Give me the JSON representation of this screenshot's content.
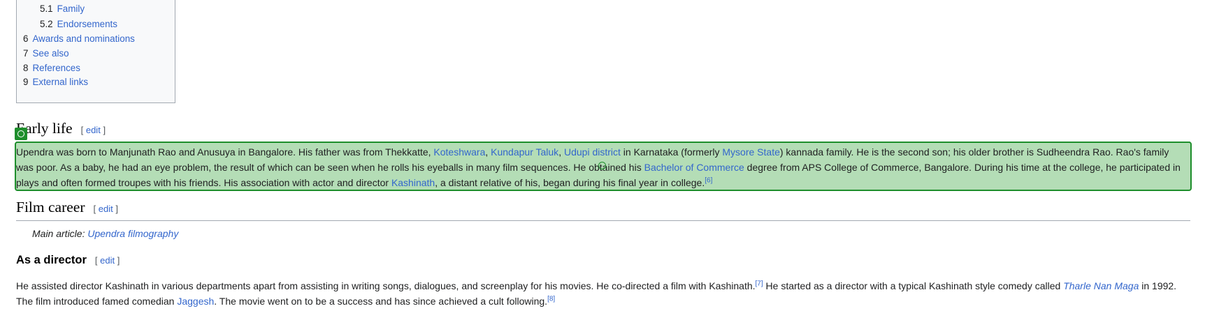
{
  "toc": {
    "items": [
      {
        "num": "5.1",
        "label": "Family",
        "indent": true
      },
      {
        "num": "5.2",
        "label": "Endorsements",
        "indent": true
      },
      {
        "num": "6",
        "label": "Awards and nominations",
        "indent": false
      },
      {
        "num": "7",
        "label": "See also",
        "indent": false
      },
      {
        "num": "8",
        "label": "References",
        "indent": false
      },
      {
        "num": "9",
        "label": "External links",
        "indent": false
      }
    ]
  },
  "edit_open": "[",
  "edit_label": "edit",
  "edit_close": "]",
  "early_life": {
    "title": "Early life",
    "paragraph": [
      {
        "t": "Upendra was born to Manjunath Rao and Anusuya in Bangalore. His father was from Thekkatte, "
      },
      {
        "l": "Koteshwara"
      },
      {
        "t": ", "
      },
      {
        "l": "Kundapur Taluk"
      },
      {
        "t": ", "
      },
      {
        "l": "Udupi district"
      },
      {
        "t": " in Karnataka (formerly "
      },
      {
        "l": "Mysore State"
      },
      {
        "t": ") kannada family. He is the second son; his older brother is Sudheendra Rao. Rao's family was poor. As a baby, he had an eye problem, the result of which can be seen when he rolls his eyeballs in many film sequences. He obtained his "
      },
      {
        "l": "Bachelor of Commerce"
      },
      {
        "t": " degree from APS College of Commerce, Bangalore. During his time at the college, he participated in plays and often formed troupes with his friends. His association with actor and director "
      },
      {
        "l": "Kashinath"
      },
      {
        "t": ", a distant relative of his, began during his final year in college."
      },
      {
        "s": "[6]"
      }
    ]
  },
  "film_career": {
    "title": "Film career",
    "hatnote_prefix": "Main article: ",
    "hatnote_link": "Upendra filmography"
  },
  "as_director": {
    "title": "As a director",
    "paragraph": [
      {
        "t": "He assisted director Kashinath in various departments apart from assisting in writing songs, dialogues, and screenplay for his movies. He co-directed a film with Kashinath."
      },
      {
        "s": "[7]"
      },
      {
        "t": " He started as a director with a typical Kashinath style comedy called "
      },
      {
        "l": "Tharle Nan Maga",
        "i": true
      },
      {
        "t": " in 1992. The film introduced famed comedian "
      },
      {
        "l": "Jaggesh"
      },
      {
        "t": ". The movie went on to be a success and has since achieved a cult following."
      },
      {
        "s": "[8]"
      }
    ]
  }
}
